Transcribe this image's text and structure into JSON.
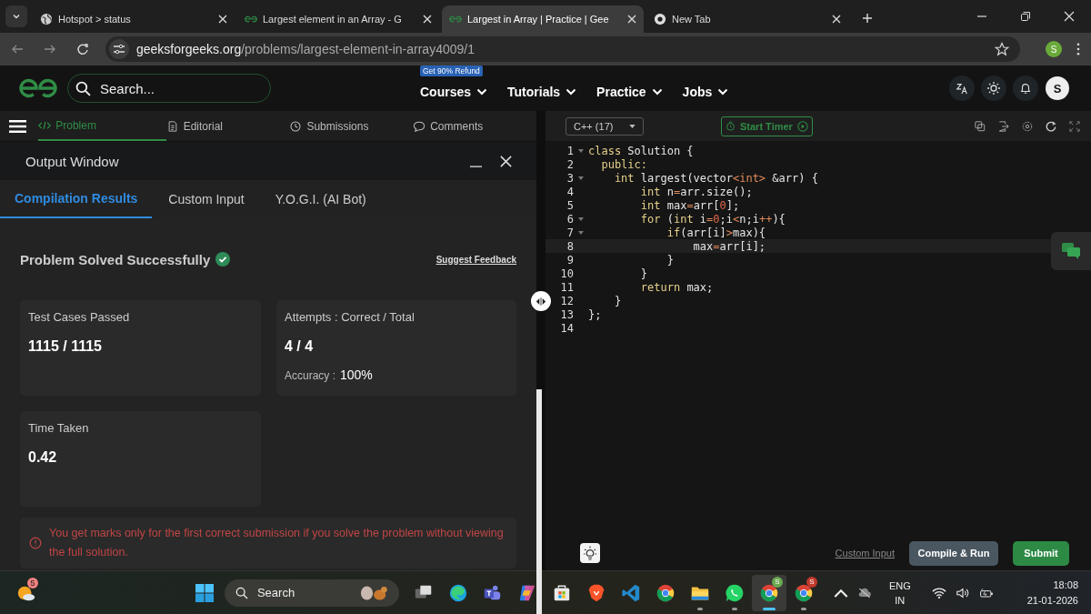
{
  "browser": {
    "tabs": [
      {
        "title": "Hotspot > status",
        "kind": "globe",
        "selected": false
      },
      {
        "title": "Largest element in an Array - G",
        "kind": "gfg",
        "selected": false
      },
      {
        "title": "Largest in Array | Practice | Gee",
        "kind": "gfg",
        "selected": true
      },
      {
        "title": "New Tab",
        "kind": "chrome",
        "selected": false
      }
    ],
    "address": {
      "host": "geeksforgeeks.org",
      "path": "/problems/largest-element-in-array4009/1"
    },
    "profile": "S"
  },
  "site": {
    "search_placeholder": "Search...",
    "badge": "Get 90% Refund",
    "nav": [
      "Courses",
      "Tutorials",
      "Practice",
      "Jobs"
    ],
    "avatar": "S"
  },
  "problem_tabs": [
    {
      "label": "Problem",
      "selected": true
    },
    {
      "label": "Editorial",
      "selected": false
    },
    {
      "label": "Submissions",
      "selected": false
    },
    {
      "label": "Comments",
      "selected": false
    }
  ],
  "output": {
    "title": "Output Window",
    "tabs": [
      {
        "label": "Compilation Results",
        "selected": true
      },
      {
        "label": "Custom Input",
        "selected": false
      },
      {
        "label": "Y.O.G.I. (AI Bot)",
        "selected": false
      }
    ],
    "status": "Problem Solved Successfully",
    "feedback": "Suggest Feedback",
    "cards": [
      {
        "label": "Test Cases Passed",
        "value": "1115 / 1115"
      },
      {
        "label": "Attempts : Correct / Total",
        "value": "4 / 4",
        "extra_label": "Accuracy :",
        "extra_value": "100%"
      },
      {
        "label": "Time Taken",
        "value": "0.42"
      }
    ],
    "notice": "You get marks only for the first correct submission if you solve the problem without viewing the full solution."
  },
  "editor": {
    "language": "C++ (17)",
    "timer": "Start Timer",
    "lines": [
      {
        "number": "1",
        "fold": true,
        "current": false,
        "segments": [
          {
            "text": "class",
            "kind": "kw"
          },
          {
            "text": " Solution {",
            "kind": "plain"
          }
        ]
      },
      {
        "number": "2",
        "fold": false,
        "current": false,
        "segments": [
          {
            "text": "  public:",
            "kind": "kw"
          }
        ]
      },
      {
        "number": "3",
        "fold": true,
        "current": false,
        "segments": [
          {
            "text": "    int",
            "kind": "kw"
          },
          {
            "text": " largest(vector",
            "kind": "plain"
          },
          {
            "text": "<int>",
            "kind": "op"
          },
          {
            "text": " &arr) {",
            "kind": "plain"
          }
        ]
      },
      {
        "number": "4",
        "fold": false,
        "current": false,
        "segments": [
          {
            "text": "        int",
            "kind": "kw"
          },
          {
            "text": " n",
            "kind": "plain"
          },
          {
            "text": "=",
            "kind": "op"
          },
          {
            "text": "arr.size();",
            "kind": "plain"
          }
        ]
      },
      {
        "number": "5",
        "fold": false,
        "current": false,
        "segments": [
          {
            "text": "        int",
            "kind": "kw"
          },
          {
            "text": " max",
            "kind": "plain"
          },
          {
            "text": "=",
            "kind": "op"
          },
          {
            "text": "arr[",
            "kind": "plain"
          },
          {
            "text": "0",
            "kind": "num"
          },
          {
            "text": "];",
            "kind": "plain"
          }
        ]
      },
      {
        "number": "6",
        "fold": true,
        "current": false,
        "segments": [
          {
            "text": "        for",
            "kind": "kw"
          },
          {
            "text": " (",
            "kind": "plain"
          },
          {
            "text": "int",
            "kind": "kw"
          },
          {
            "text": " i",
            "kind": "plain"
          },
          {
            "text": "=",
            "kind": "op"
          },
          {
            "text": "0",
            "kind": "num"
          },
          {
            "text": ";i",
            "kind": "plain"
          },
          {
            "text": "<",
            "kind": "op"
          },
          {
            "text": "n;i",
            "kind": "plain"
          },
          {
            "text": "++",
            "kind": "op"
          },
          {
            "text": "){",
            "kind": "plain"
          }
        ]
      },
      {
        "number": "7",
        "fold": true,
        "current": false,
        "segments": [
          {
            "text": "            if",
            "kind": "kw"
          },
          {
            "text": "(arr[i]",
            "kind": "plain"
          },
          {
            "text": ">",
            "kind": "op"
          },
          {
            "text": "max){",
            "kind": "plain"
          }
        ]
      },
      {
        "number": "8",
        "fold": false,
        "current": true,
        "segments": [
          {
            "text": "                max",
            "kind": "plain"
          },
          {
            "text": "=",
            "kind": "op"
          },
          {
            "text": "arr[i];",
            "kind": "plain"
          }
        ]
      },
      {
        "number": "9",
        "fold": false,
        "current": false,
        "segments": [
          {
            "text": "            }",
            "kind": "plain"
          }
        ]
      },
      {
        "number": "10",
        "fold": false,
        "current": false,
        "segments": [
          {
            "text": "        }",
            "kind": "plain"
          }
        ]
      },
      {
        "number": "11",
        "fold": false,
        "current": false,
        "segments": [
          {
            "text": "        return",
            "kind": "kw"
          },
          {
            "text": " max;",
            "kind": "plain"
          }
        ]
      },
      {
        "number": "12",
        "fold": false,
        "current": false,
        "segments": [
          {
            "text": "    }",
            "kind": "plain"
          }
        ]
      },
      {
        "number": "13",
        "fold": false,
        "current": false,
        "segments": [
          {
            "text": "};",
            "kind": "plain"
          }
        ]
      },
      {
        "number": "14",
        "fold": false,
        "current": false
      }
    ],
    "custom_input": "Custom Input",
    "run": "Compile & Run",
    "submit": "Submit"
  },
  "taskbar": {
    "weather_badge": "5",
    "search": "Search",
    "apps": [
      {
        "kind": "taskview",
        "running": false,
        "selected": false
      },
      {
        "kind": "edge",
        "running": false,
        "selected": false
      },
      {
        "kind": "teams",
        "running": false,
        "selected": false
      },
      {
        "kind": "copilot",
        "running": false,
        "selected": false
      },
      {
        "kind": "store",
        "running": false,
        "selected": false
      },
      {
        "kind": "brave",
        "running": false,
        "selected": false
      },
      {
        "kind": "vscode",
        "running": false,
        "selected": false
      },
      {
        "kind": "chrome",
        "running": false,
        "selected": false
      },
      {
        "kind": "files",
        "running": true,
        "selected": false
      },
      {
        "kind": "whatsapp",
        "running": true,
        "selected": false
      },
      {
        "kind": "chrome",
        "running": true,
        "selected": true,
        "badge": "S",
        "color": "#6aa84f"
      },
      {
        "kind": "chrome",
        "running": true,
        "selected": false,
        "badge": "S",
        "color": "#c0392b"
      }
    ],
    "language": "ENG",
    "region": "IN",
    "time": "18:08",
    "date": "21-01-2026"
  }
}
